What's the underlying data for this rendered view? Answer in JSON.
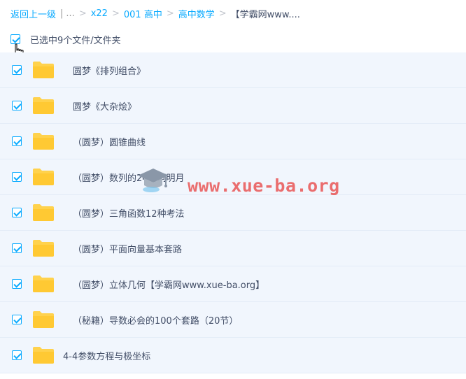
{
  "breadcrumb": {
    "back": "返回上一级",
    "divider": "|",
    "ellipsis": "...",
    "sep": ">",
    "items": [
      "x22",
      "001 高中",
      "高中数学"
    ],
    "current": "【学霸网www...."
  },
  "selection": {
    "label": "已选中9个文件/文件夹",
    "checked": true
  },
  "files": [
    {
      "name": "圆梦《排列组合》",
      "checked": true
    },
    {
      "name": "圆梦《大杂烩》",
      "checked": true
    },
    {
      "name": "（圆梦）圆锥曲线",
      "checked": true
    },
    {
      "name": "（圆梦）数列的24桥洞明月",
      "checked": true
    },
    {
      "name": "（圆梦）三角函数12种考法",
      "checked": true
    },
    {
      "name": "（圆梦）平面向量基本套路",
      "checked": true
    },
    {
      "name": "（圆梦）立体几何【学霸网www.xue-ba.org】",
      "checked": true
    },
    {
      "name": "（秘籍）导数必会的100个套路（20节）",
      "checked": true
    },
    {
      "name": "4-4参数方程与极坐标",
      "checked": true
    }
  ],
  "watermark": {
    "text": "www.xue-ba.org",
    "color": "#e94f4f"
  },
  "colors": {
    "accent": "#09aaff",
    "row_bg": "#f1f6fd",
    "folder": "#ffd24d"
  }
}
